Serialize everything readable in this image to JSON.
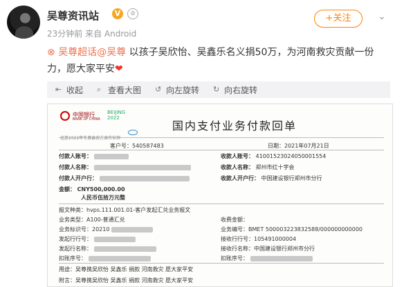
{
  "user": {
    "name": "吴尊资讯站",
    "meta": "23分钟前 来自 Android",
    "follow_label": "+关注",
    "more": "⌄"
  },
  "post": {
    "topic": "吴尊超话",
    "mention": "@吴尊",
    "text": "以孩子吴欣怡、吴鑫乐名义捐50万，为河南救灾贡献一份力，愿大家平安",
    "heart": "❤"
  },
  "toolbar": {
    "collapse": "收起",
    "view_large": "查看大图",
    "rotate_left": "向左旋转",
    "rotate_right": "向右旋转"
  },
  "receipt": {
    "bank_name": "中国银行",
    "bank_sub": "BANK OF CHINA",
    "bj_mark": "BEIJING 2022",
    "partner_line": "北京2022年冬奥会官方合作伙伴",
    "title": "国内支付业务付款回单",
    "customer_no_label": "客户号：",
    "customer_no": "540587483",
    "date_label": "日期：",
    "date": "2021年07月21日",
    "payer_account_label": "付款人账号：",
    "payee_account_label": "收款人账号：",
    "payee_account": "41001523024050001554",
    "payer_name_label": "付款人名称：",
    "payee_name_label": "收款人名称：",
    "payee_name": "郑州市红十字会",
    "payer_bank_label": "付款人开户行：",
    "payee_bank_label": "收款人开户行：",
    "payee_bank": "中国建设银行郑州市分行",
    "amount_label": "金额：",
    "amount": "CNY500,000.00",
    "amount_words": "人民币伍拾万元整",
    "msg_type_label": "报文种类：",
    "msg_type": "hvps.111.001.01-客户发起汇兑业务报文",
    "business_type_label": "业务类型：",
    "business_type": "A100-普通汇兑",
    "business_no_label": "业务标识号：",
    "business_no": "20210",
    "origin_bank_label": "发起行行号：",
    "sender_name_label": "发起行名称：",
    "debit_no_label": "扣账序号：",
    "fee_label": "收费金额：",
    "bank_ref_label": "业务编号：",
    "bank_ref": "BMET 500003223832588/000000000000",
    "recv_bank_no_label": "接收行行号：",
    "recv_bank_no": "105491000004",
    "recv_bank_name_label": "接收行名称：",
    "recv_bank_name": "中国建设银行郑州市分行",
    "debit_no2_label": "扣账序号：",
    "purpose_label": "用途：",
    "purpose": "吴尊携吴欣怡 吴鑫乐 捐款 河南救灾 愿大家平安",
    "remark_label": "附言：",
    "remark": "吴尊携吴欣怡 吴鑫乐 捐款 河南救灾 愿大家平安"
  }
}
